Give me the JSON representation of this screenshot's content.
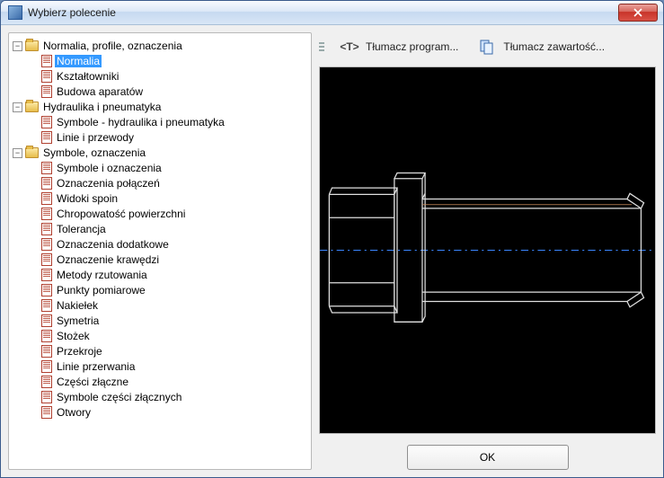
{
  "window": {
    "title": "Wybierz polecenie"
  },
  "toolbar": {
    "translate_program": "Tłumacz program...",
    "translate_content": "Tłumacz zawartość..."
  },
  "buttons": {
    "ok": "OK"
  },
  "tree": [
    {
      "label": "Normalia, profile, oznaczenia",
      "expanded": true,
      "children": [
        {
          "label": "Normalia",
          "selected": true
        },
        {
          "label": "Kształtowniki"
        },
        {
          "label": "Budowa aparatów"
        }
      ]
    },
    {
      "label": "Hydraulika i pneumatyka",
      "expanded": true,
      "children": [
        {
          "label": "Symbole - hydraulika i pneumatyka"
        },
        {
          "label": "Linie i przewody"
        }
      ]
    },
    {
      "label": "Symbole, oznaczenia",
      "expanded": true,
      "children": [
        {
          "label": "Symbole i oznaczenia"
        },
        {
          "label": "Oznaczenia połączeń"
        },
        {
          "label": "Widoki spoin"
        },
        {
          "label": "Chropowatość powierzchni"
        },
        {
          "label": "Tolerancja"
        },
        {
          "label": "Oznaczenia dodatkowe"
        },
        {
          "label": "Oznaczenie krawędzi"
        },
        {
          "label": "Metody rzutowania"
        },
        {
          "label": "Punkty pomiarowe"
        },
        {
          "label": "Nakiełek"
        },
        {
          "label": "Symetria"
        },
        {
          "label": "Stożek"
        },
        {
          "label": "Przekroje"
        },
        {
          "label": "Linie przerwania"
        },
        {
          "label": "Części złączne"
        },
        {
          "label": "Symbole części złącznych"
        },
        {
          "label": "Otwory"
        }
      ]
    }
  ]
}
